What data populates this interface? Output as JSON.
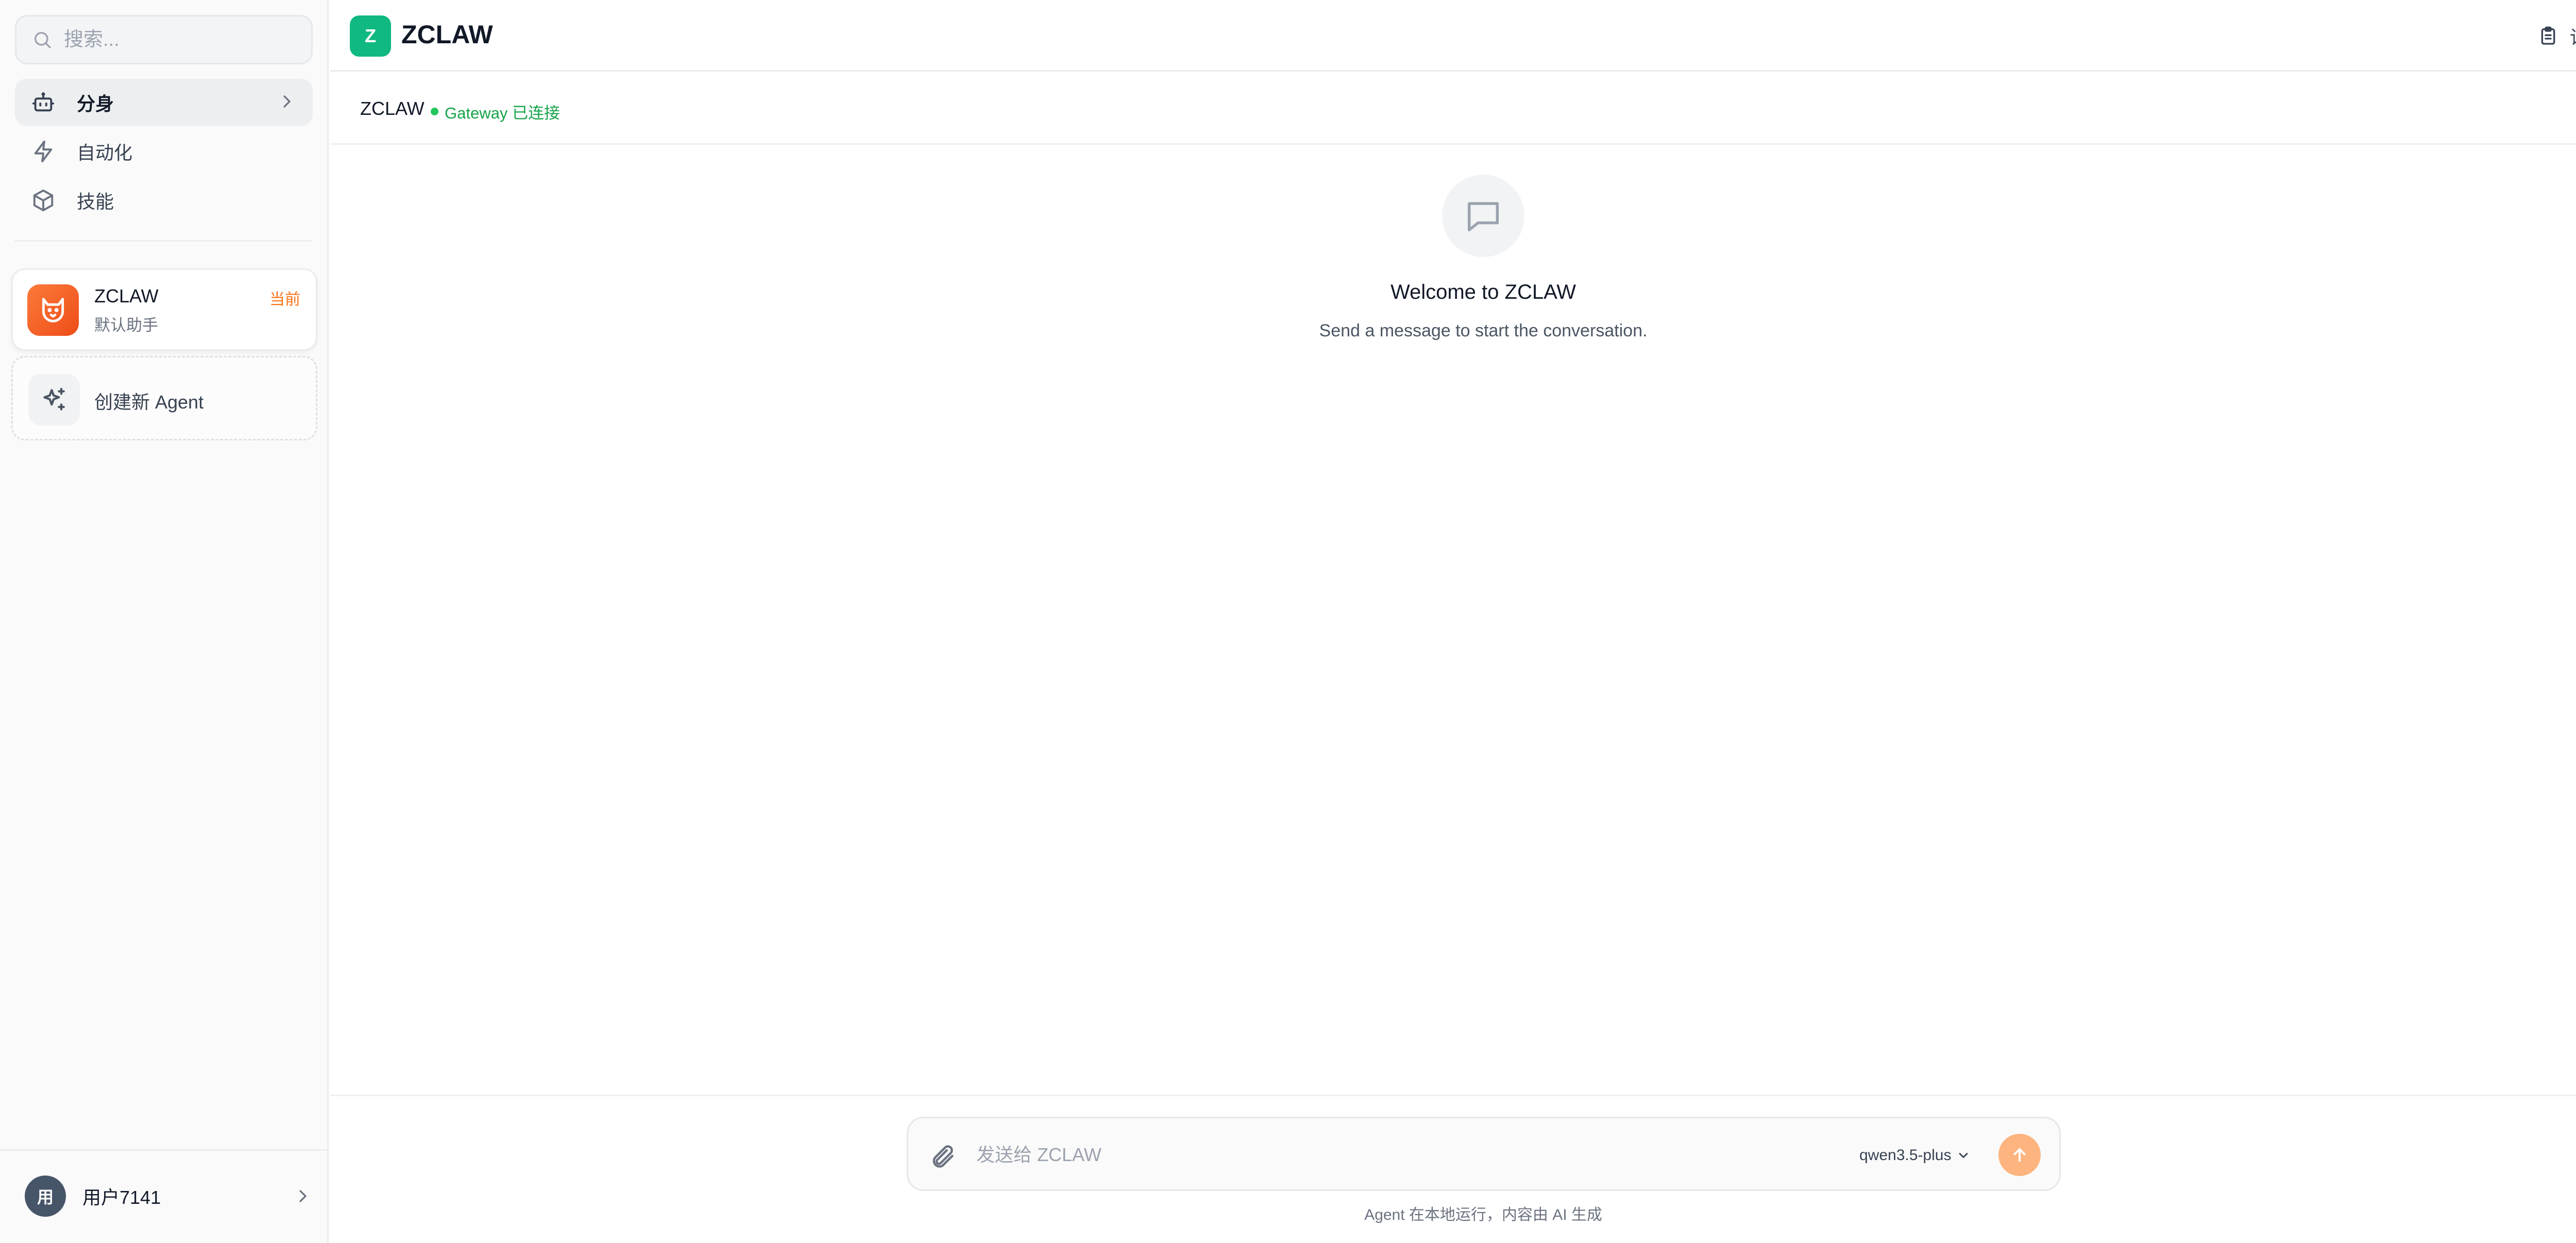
{
  "sidebar": {
    "search_placeholder": "搜索...",
    "nav": [
      {
        "label": "分身",
        "icon": "bot-icon",
        "active": true
      },
      {
        "label": "自动化",
        "icon": "lightning-icon",
        "active": false
      },
      {
        "label": "技能",
        "icon": "cube-icon",
        "active": false
      }
    ],
    "agents": [
      {
        "name": "ZCLAW",
        "description": "默认助手",
        "badge": "当前",
        "icon": "cat-face-icon"
      }
    ],
    "create_agent_label": "创建新 Agent",
    "user": {
      "avatar_text": "用",
      "name": "用户7141"
    }
  },
  "header": {
    "logo_letter": "Z",
    "title": "ZCLAW",
    "detail_label": "详情"
  },
  "conversation": {
    "title": "ZCLAW",
    "status": "Gateway 已连接",
    "status_color": "#22c55e"
  },
  "welcome": {
    "title": "Welcome to ZCLAW",
    "subtitle": "Send a message to start the conversation."
  },
  "composer": {
    "placeholder": "发送给 ZCLAW",
    "model": "qwen3.5-plus",
    "footer_note": "Agent 在本地运行，内容由 AI 生成"
  },
  "colors": {
    "brand": "#10b981",
    "accent": "#f97316",
    "send": "#fdb47e"
  }
}
